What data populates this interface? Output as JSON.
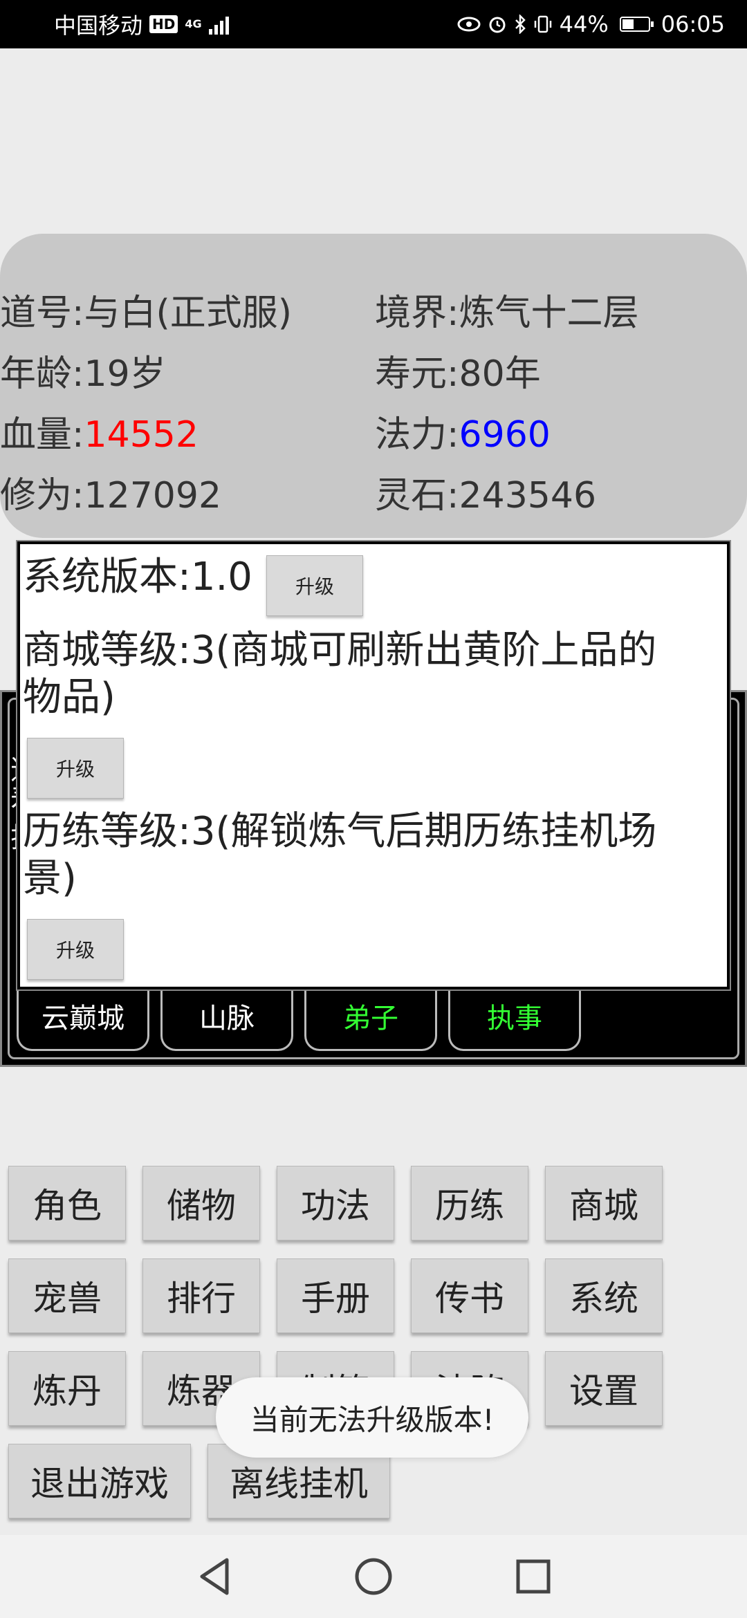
{
  "status_bar": {
    "carrier": "中国移动",
    "hd_badge": "HD",
    "network": "4G",
    "battery_percent": "44%",
    "battery_level": 0.44,
    "time": "06:05"
  },
  "stats": {
    "daohao": "道号:与白(正式服)",
    "jingjie": "境界:炼气十二层",
    "age": "年龄:19岁",
    "shouyuan": "寿元:80年",
    "hp_label": "血量:",
    "hp_value": "14552",
    "mana_label": "法力:",
    "mana_value": "6960",
    "xiuwei": "修为:127092",
    "lingshi": "灵石:243546",
    "colors": {
      "hp": "#ff0000",
      "mana": "#0000ff"
    }
  },
  "background_panel": {
    "partial_chars": [
      "道",
      "寿",
      "排"
    ],
    "tabs": [
      {
        "label": "云巅城",
        "color": "#ffffff"
      },
      {
        "label": "山脉",
        "color": "#ffffff"
      },
      {
        "label": "弟子",
        "color": "#33ff33"
      },
      {
        "label": "执事",
        "color": "#33ff33"
      }
    ]
  },
  "dialog": {
    "system_version": "系统版本:1.0",
    "shop_level_line1": "商城等级:3(商城可刷新出黄阶上品的",
    "shop_level_line2": "物品)",
    "training_level_line1": "历练等级:3(解锁炼气后期历练挂机场",
    "training_level_line2": "景)",
    "upgrade_label": "升级"
  },
  "menu": {
    "row1": [
      "角色",
      "储物",
      "功法",
      "历练",
      "商城"
    ],
    "row2": [
      "宠兽",
      "排行",
      "手册",
      "传书",
      "系统"
    ],
    "row3": [
      "炼丹",
      "炼器",
      "制符",
      "法阵",
      "设置"
    ],
    "row4": [
      "退出游戏",
      "离线挂机"
    ]
  },
  "toast": "当前无法升级版本!"
}
